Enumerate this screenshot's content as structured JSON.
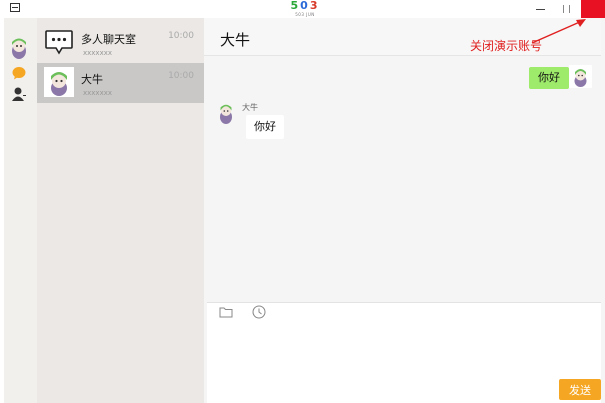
{
  "titlebar": {
    "logo_digits": [
      "5",
      "0",
      "3"
    ],
    "logo_subtitle": "503 JUN",
    "colors": {
      "close_button": "#e81123",
      "logo_5": "#2aa838",
      "logo_0": "#2a6ad8",
      "logo_3": "#d83a2a"
    }
  },
  "nav": {
    "icons": [
      "user-avatar-icon",
      "chat-bubble-icon",
      "contact-icon"
    ],
    "colors": {
      "chat_icon": "#f5a623"
    }
  },
  "conversations": [
    {
      "name": "多人聊天室",
      "preview": "xxxxxxx",
      "time": "10:00",
      "icon": "group-chat-icon",
      "selected": false
    },
    {
      "name": "大牛",
      "preview": "xxxxxxx",
      "time": "10:00",
      "icon": "avatar-icon",
      "selected": true
    }
  ],
  "chat": {
    "title": "大牛",
    "annotation": "关闭演示账号",
    "messages": [
      {
        "direction": "out",
        "text": "你好"
      },
      {
        "direction": "in",
        "sender": "大牛",
        "text": "你好"
      }
    ],
    "toolbar_icons": [
      "folder-icon",
      "clock-icon"
    ],
    "send_label": "发送",
    "colors": {
      "outgoing_bubble": "#9eea6a",
      "send_button": "#f5a623",
      "annotation": "#e02020"
    }
  }
}
